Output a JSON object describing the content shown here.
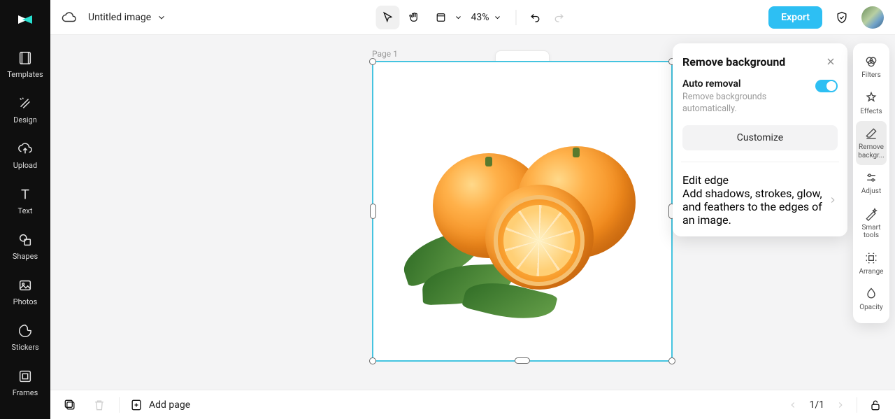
{
  "header": {
    "title": "Untitled image",
    "zoom": "43%",
    "export_label": "Export"
  },
  "left_rail": {
    "items": [
      {
        "label": "Templates"
      },
      {
        "label": "Design"
      },
      {
        "label": "Upload"
      },
      {
        "label": "Text"
      },
      {
        "label": "Shapes"
      },
      {
        "label": "Photos"
      },
      {
        "label": "Stickers"
      },
      {
        "label": "Frames"
      }
    ]
  },
  "canvas": {
    "page_label": "Page 1"
  },
  "panel": {
    "title": "Remove background",
    "auto": {
      "title": "Auto removal",
      "subtitle": "Remove backgrounds automatically.",
      "enabled": true
    },
    "customize_label": "Customize",
    "edit_edge": {
      "title": "Edit edge",
      "subtitle": "Add shadows, strokes, glow, and feathers to the edges of an image."
    }
  },
  "right_rail": {
    "items": [
      {
        "label": "Filters"
      },
      {
        "label": "Effects"
      },
      {
        "label": "Remove backgr..."
      },
      {
        "label": "Adjust"
      },
      {
        "label": "Smart tools"
      },
      {
        "label": "Arrange"
      },
      {
        "label": "Opacity"
      }
    ],
    "active_index": 2
  },
  "bottom": {
    "add_page_label": "Add page",
    "page_indicator": "1/1"
  }
}
